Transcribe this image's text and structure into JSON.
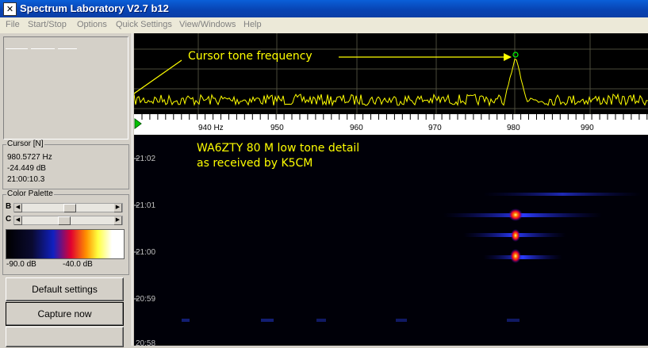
{
  "window": {
    "title": "Spectrum Laboratory V2.7 b12",
    "icon": "app-logo-icon"
  },
  "menu": [
    "File",
    "Start/Stop",
    "Options",
    "Quick Settings",
    "View/Windows",
    "Help"
  ],
  "cursor_panel": {
    "label": "Cursor [N]",
    "frequency": "980.5727 Hz",
    "level": "-24.449 dB",
    "time": "21:00:10.3"
  },
  "palette": {
    "label": "Color Palette",
    "brightness_label": "B",
    "contrast_label": "C",
    "brightness_level": 0.52,
    "contrast_level": 0.45,
    "min_label": "-90.0 dB",
    "max_label": "-40.0 dB"
  },
  "buttons": {
    "default_settings": "Default settings",
    "capture_now": "Capture now"
  },
  "frequency_axis": {
    "unit_label": "940 Hz",
    "tick_labels": [
      "950",
      "960",
      "970",
      "980",
      "990"
    ]
  },
  "time_labels": [
    "21:02",
    "21:01",
    "21:00",
    "20:59",
    "20:58"
  ],
  "annotations": {
    "spectrum_note": "Cursor tone frequency",
    "waterfall_note_line1": "WA6ZTY 80 M low tone detail",
    "waterfall_note_line2": "as received by K5CM"
  },
  "colors": {
    "trace": "#ffff00",
    "annotation": "#ffff00",
    "cursor_marker": "#00ff00",
    "titlebar": "#0a4fc4"
  }
}
